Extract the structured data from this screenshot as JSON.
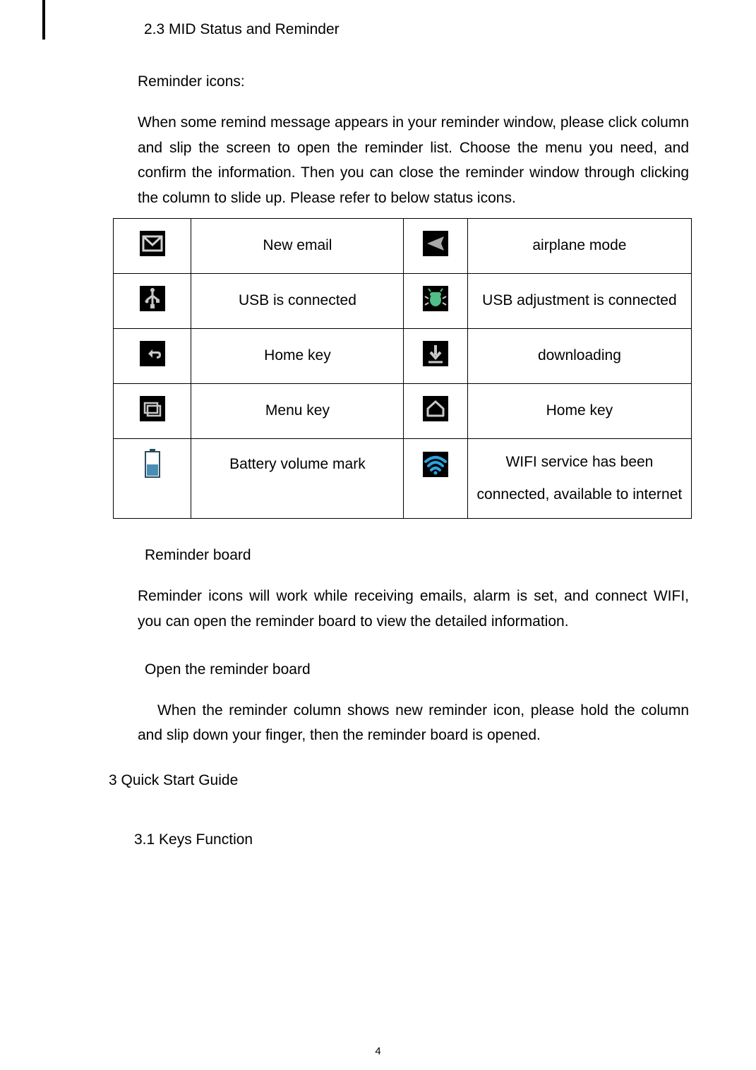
{
  "headings": {
    "sec23": "2.3 MID Status and Reminder",
    "reminder_icons": "Reminder icons:",
    "reminder_board": "Reminder board",
    "open_board": "Open the reminder board",
    "chap3": "3 Quick Start Guide",
    "sec31": "3.1 Keys Function"
  },
  "paragraphs": {
    "p1": "When some remind message appears in your reminder window, please click column and slip the screen to open the reminder list. Choose the menu you need, and confirm the information. Then you can close the reminder window through clicking the column to slide up. Please refer to below status icons.",
    "p2": "Reminder icons will work while receiving emails, alarm is set, and connect WIFI, you can open the reminder board to view the detailed information.",
    "p3": "When the reminder column shows new reminder icon, please hold the column and slip down your finger, then the reminder board is opened."
  },
  "table": {
    "rows": [
      {
        "left_icon": "email",
        "left_label": "New email",
        "right_icon": "airplane",
        "right_label": "airplane mode"
      },
      {
        "left_icon": "usb",
        "left_label": "USB is connected",
        "right_icon": "usbadj",
        "right_label": "USB adjustment is connected"
      },
      {
        "left_icon": "back",
        "left_label": "Home key",
        "right_icon": "download",
        "right_label": "downloading"
      },
      {
        "left_icon": "menu",
        "left_label": "Menu key",
        "right_icon": "home",
        "right_label": "Home key"
      },
      {
        "left_icon": "battery",
        "left_label": "Battery volume mark",
        "right_icon": "wifi",
        "right_label": "WIFI service has been connected, available to internet"
      }
    ]
  },
  "page_number": "4"
}
